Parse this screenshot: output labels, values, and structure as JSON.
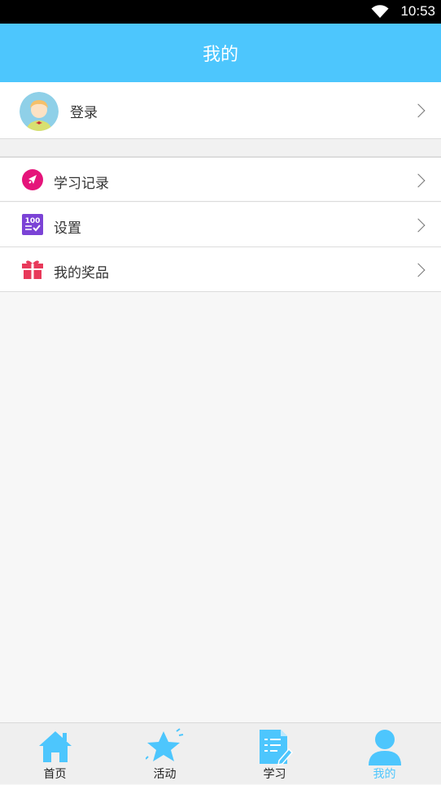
{
  "status_bar": {
    "time": "10:53"
  },
  "header": {
    "title": "我的"
  },
  "login": {
    "label": "登录"
  },
  "menu": [
    {
      "label": "学习记录",
      "icon": "rocket-icon",
      "color": "#e5147a"
    },
    {
      "label": "设置",
      "icon": "score-100-icon",
      "color": "#7b43d6"
    },
    {
      "label": "我的奖品",
      "icon": "gift-icon",
      "color": "#e8395a"
    }
  ],
  "tabs": [
    {
      "label": "首页",
      "icon": "home-icon"
    },
    {
      "label": "活动",
      "icon": "star-icon"
    },
    {
      "label": "学习",
      "icon": "document-icon"
    },
    {
      "label": "我的",
      "icon": "person-icon",
      "active": true
    }
  ],
  "colors": {
    "accent": "#4dc6fd"
  }
}
